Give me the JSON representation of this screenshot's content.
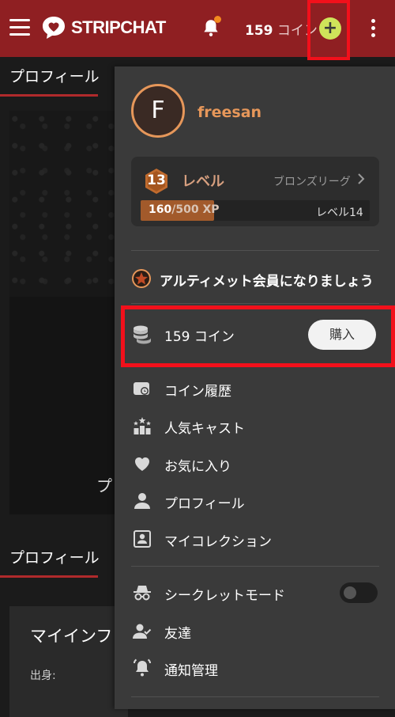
{
  "header": {
    "brand": "STRIPCHAT",
    "coins_amount": "159",
    "coins_unit": "コイン",
    "add_button": "+"
  },
  "background": {
    "tab_profile": "プロフィール",
    "partial_text": "プ",
    "tab_profile_2": "プロフィール",
    "card_title": "マイインフ",
    "card_label": "出身:"
  },
  "dropdown": {
    "avatar_initial": "F",
    "username": "freesan",
    "level": {
      "number": "13",
      "title": "レベル",
      "league": "ブロンズリーグ",
      "xp_current": "160",
      "xp_total": "/500 XP",
      "xp_progress": 0.32,
      "next_level": "レベル14"
    },
    "ultimate_text": "アルティメット会員になりましょう",
    "coins_text": "159 コイン",
    "buy_label": "購入",
    "menu": [
      {
        "label": "コイン履歴",
        "icon": "wallet-icon"
      },
      {
        "label": "人気キャスト",
        "icon": "stars-podium-icon"
      },
      {
        "label": "お気に入り",
        "icon": "heart-icon"
      },
      {
        "label": "プロフィール",
        "icon": "person-icon"
      },
      {
        "label": "マイコレクション",
        "icon": "collection-icon"
      }
    ],
    "menu2": [
      {
        "label": "シークレットモード",
        "icon": "incognito-icon"
      },
      {
        "label": "友達",
        "icon": "friends-icon"
      },
      {
        "label": "通知管理",
        "icon": "bell-settings-icon"
      }
    ],
    "secret_mode_on": false
  },
  "colors": {
    "topbar": "#8f1f22",
    "accent_orange": "#e6975a",
    "highlight_red": "#f2101b",
    "plus_green": "#cfe35a"
  }
}
